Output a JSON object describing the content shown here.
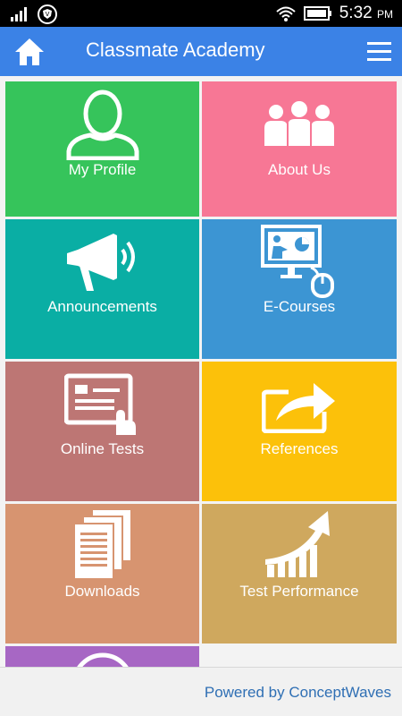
{
  "status_bar": {
    "time": "5:32",
    "ampm": "PM"
  },
  "app_bar": {
    "title": "Classmate Academy"
  },
  "tiles": [
    {
      "label": "My Profile",
      "color": "#36c45b",
      "icon": "person-icon"
    },
    {
      "label": "About Us",
      "color": "#f77795",
      "icon": "group-icon"
    },
    {
      "label": "Announcements",
      "color": "#0aaea4",
      "icon": "megaphone-icon"
    },
    {
      "label": "E-Courses",
      "color": "#3c95d3",
      "icon": "presentation-icon"
    },
    {
      "label": "Online Tests",
      "color": "#bd7674",
      "icon": "test-touch-icon"
    },
    {
      "label": "References",
      "color": "#fcc10a",
      "icon": "share-icon"
    },
    {
      "label": "Downloads",
      "color": "#d79470",
      "icon": "documents-icon"
    },
    {
      "label": "Test Performance",
      "color": "#cfa85e",
      "icon": "growth-chart-icon"
    },
    {
      "label": "",
      "color": "#a767c4",
      "icon": "play-icon"
    }
  ],
  "footer": {
    "powered_by": "Powered by ConceptWaves"
  }
}
